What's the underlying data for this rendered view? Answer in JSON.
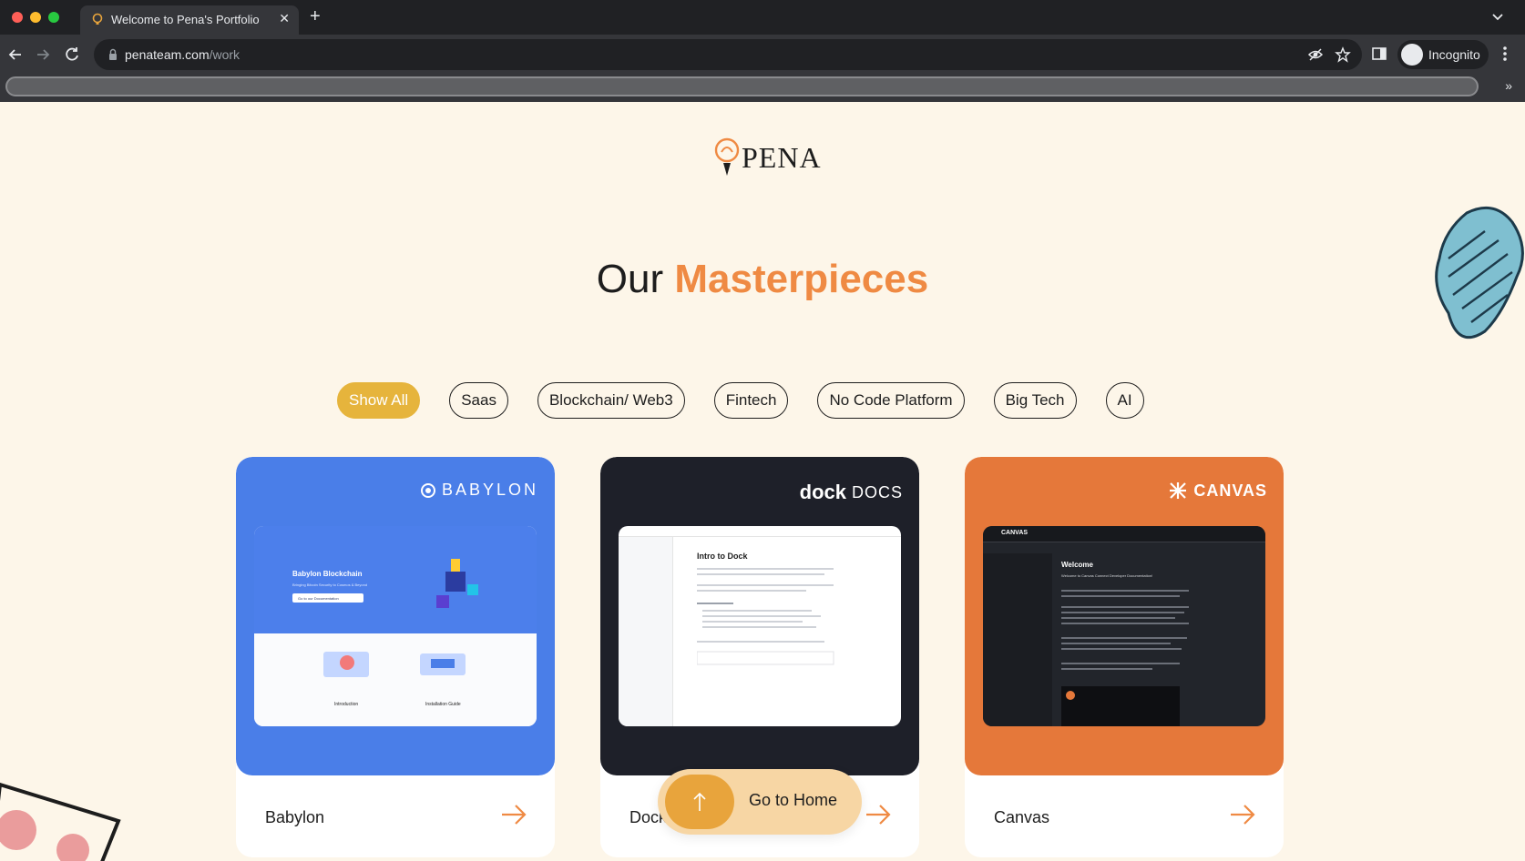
{
  "browser": {
    "tab_title": "Welcome to Pena's Portfolio",
    "url_host": "penateam.com",
    "url_path": "/work",
    "profile_label": "Incognito"
  },
  "page": {
    "logo_text": "PENA",
    "heading_plain": "Our",
    "heading_accent": "Masterpieces",
    "filters": [
      "Show All",
      "Saas",
      "Blockchain/ Web3",
      "Fintech",
      "No Code Platform",
      "Big Tech",
      "AI"
    ],
    "active_filter": "Show All",
    "cards": [
      {
        "name": "Babylon",
        "brand": "BABYLON",
        "color": "#4a7ee8"
      },
      {
        "name": "Dock",
        "brand": "DOCS",
        "brand_logo": "dock",
        "color": "#1e2029"
      },
      {
        "name": "Canvas",
        "brand": "CANVAS",
        "color": "#e5783a"
      }
    ],
    "babylon_shot": {
      "title": "Babylon Blockchain",
      "subtitle": "Bringing Bitcoin Security to Cosmos & Beyond",
      "button": "Go to our Documentation",
      "item1": "Introduction",
      "item2": "Installation Guide"
    },
    "dock_shot": {
      "title": "Intro to Dock"
    },
    "canvas_shot": {
      "brand": "CANVAS",
      "title": "Welcome",
      "subtitle": "Welcome to Canvas Connect Developer Documentation!"
    },
    "go_home_label": "Go to Home"
  },
  "colors": {
    "accent_orange": "#ef8a43",
    "chip_active": "#e6b43c",
    "page_bg": "#fdf6e9"
  }
}
